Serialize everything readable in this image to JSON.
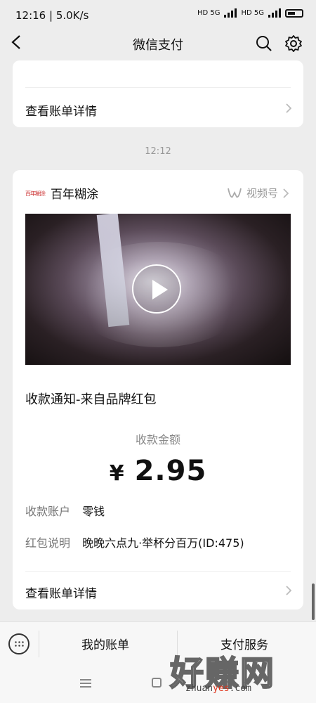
{
  "status": {
    "time": "12:16 | 5.0K/s",
    "net1": "HD 5G",
    "net2": "HD 5G"
  },
  "nav": {
    "title": "微信支付"
  },
  "card1": {
    "link_label": "查看账单详情"
  },
  "timestamp": "12:12",
  "card2": {
    "brand_logo_text": "百年糊涂",
    "brand_name": "百年糊涂",
    "channel_label": "视频号",
    "notice_title": "收款通知-来自品牌红包",
    "amount_label": "收款金额",
    "currency": "¥",
    "amount": "2.95",
    "rows": [
      {
        "key": "收款账户",
        "value": "零钱"
      },
      {
        "key": "红包说明",
        "value": "晚晚六点九·举杯分百万(ID:475)"
      }
    ],
    "link_label": "查看账单详情"
  },
  "bottom": {
    "tab1": "我的账单",
    "tab2": "支付服务"
  },
  "watermark": {
    "big": "好赚网",
    "small_pre": "zhuan",
    "small_hl": "yes",
    "small_post": ".com"
  }
}
